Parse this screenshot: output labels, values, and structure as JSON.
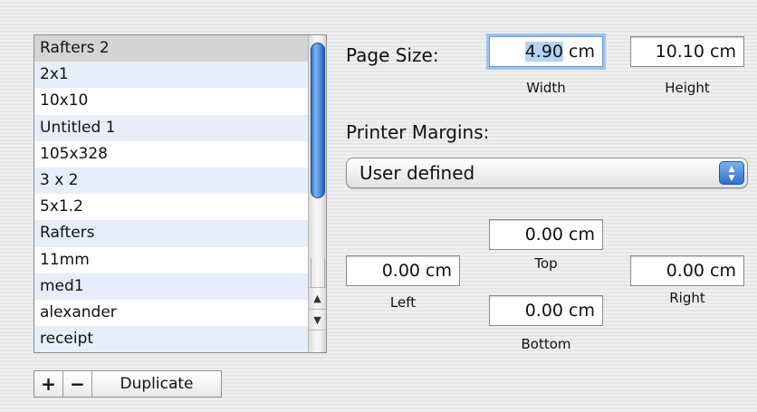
{
  "list": {
    "items": [
      "Rafters 2",
      "2x1",
      "10x10",
      "Untitled 1",
      "105x328",
      "3 x 2",
      "5x1.2",
      "Rafters",
      "11mm",
      "med1",
      "alexander",
      "receipt"
    ],
    "selected_index": 0
  },
  "list_buttons": {
    "add": "+",
    "remove": "−",
    "duplicate": "Duplicate"
  },
  "page_size": {
    "label": "Page Size:",
    "width": {
      "value": "4.90",
      "unit": " cm",
      "caption": "Width"
    },
    "height": {
      "value": "10.10 cm",
      "caption": "Height"
    }
  },
  "printer_margins": {
    "label": "Printer Margins:",
    "preset": "User defined",
    "top": {
      "value": "0.00 cm",
      "caption": "Top"
    },
    "left": {
      "value": "0.00 cm",
      "caption": "Left"
    },
    "bottom": {
      "value": "0.00 cm",
      "caption": "Bottom"
    },
    "right": {
      "value": "0.00 cm",
      "caption": "Right"
    }
  },
  "icons": {
    "scroll_up": "▲",
    "scroll_down": "▼",
    "popup_arrows": "▲▼"
  },
  "colors": {
    "accent": "#2c6fcc",
    "row_alt": "#e7eefa",
    "selection": "#b5d3f3"
  }
}
